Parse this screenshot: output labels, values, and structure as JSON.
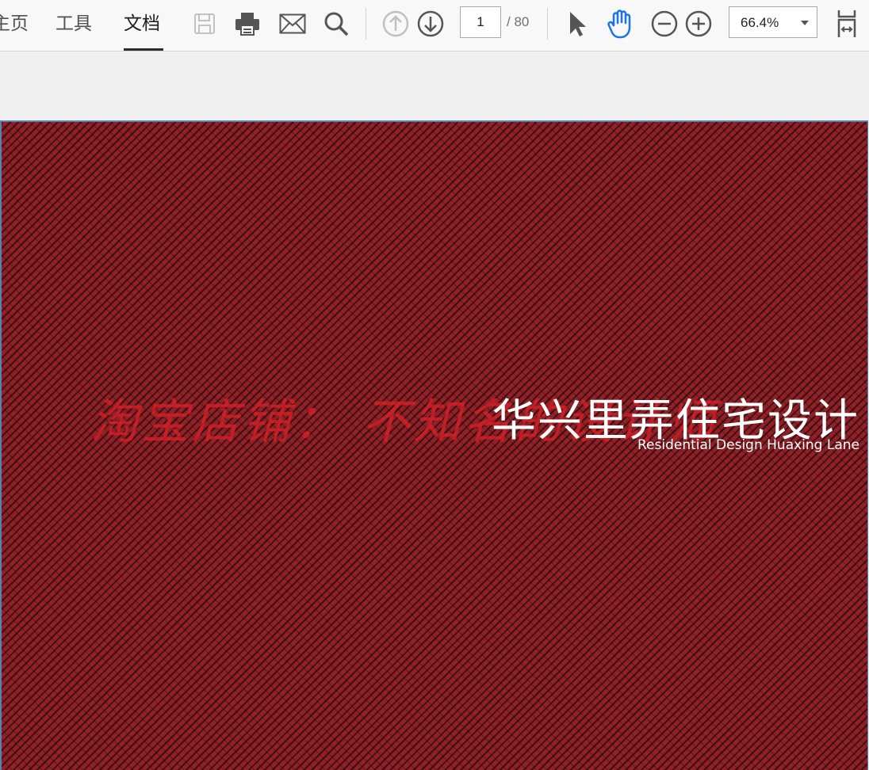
{
  "nav": {
    "tabs": [
      {
        "label": "主页"
      },
      {
        "label": "工具"
      },
      {
        "label": "文档"
      }
    ]
  },
  "toolbar": {
    "icons": [
      "save-icon",
      "print-icon",
      "email-icon",
      "search-icon",
      "previous-page-icon",
      "next-page-icon",
      "select-pointer-icon",
      "hand-tool-icon",
      "zoom-out-icon",
      "zoom-in-icon",
      "page-fit-icon"
    ],
    "page_current": "1",
    "page_total": "/ 80",
    "zoom_value": "66.4%"
  },
  "document": {
    "watermark": "淘宝店铺：  不知名的设计师",
    "title": "华兴里弄住宅设计",
    "subtitle": "Residential Design Huaxing Lane"
  },
  "colors": {
    "accent": "#1a73e8",
    "page_background": "#8f2127",
    "watermark": "#da2028"
  }
}
